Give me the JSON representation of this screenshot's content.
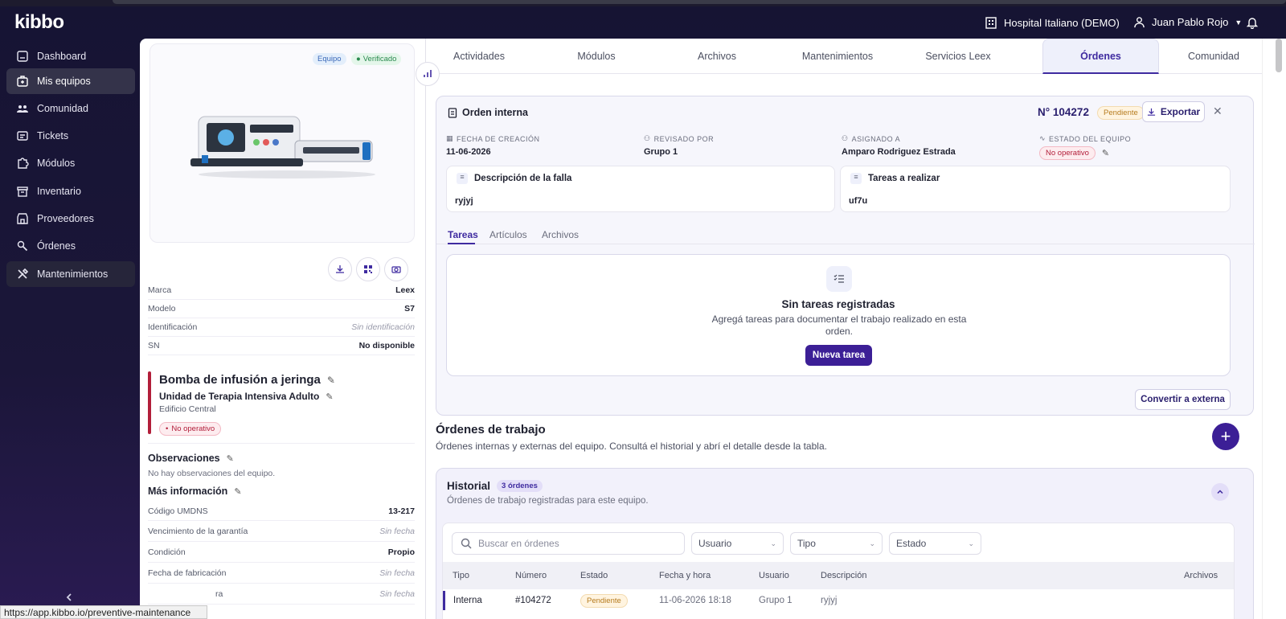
{
  "app": {
    "brand": "kibbo"
  },
  "header": {
    "hospital": "Hospital Italiano (DEMO)",
    "user": "Juan Pablo Rojo"
  },
  "sidebar": {
    "items": [
      {
        "label": "Dashboard",
        "icon": "dashboard-icon"
      },
      {
        "label": "Mis equipos",
        "icon": "equipment-icon",
        "active": true
      },
      {
        "label": "Comunidad",
        "icon": "community-icon"
      },
      {
        "label": "Tickets",
        "icon": "ticket-icon"
      },
      {
        "label": "Módulos",
        "icon": "puzzle-icon"
      },
      {
        "label": "Inventario",
        "icon": "archive-icon"
      },
      {
        "label": "Proveedores",
        "icon": "store-icon"
      },
      {
        "label": "Órdenes",
        "icon": "tools-icon"
      },
      {
        "label": "Mantenimientos",
        "icon": "maintenance-icon"
      }
    ]
  },
  "status_url": "https://app.kibbo.io/preventive-maintenance",
  "equipment": {
    "badges": {
      "equipo": "Equipo",
      "verificado": "Verificado"
    },
    "specs": [
      {
        "key": "Marca",
        "value": "Leex"
      },
      {
        "key": "Modelo",
        "value": "S7"
      },
      {
        "key": "Identificación",
        "value": "Sin identificación"
      },
      {
        "key": "SN",
        "value": "No disponible"
      }
    ],
    "name": "Bomba de infusión a jeringa",
    "unit": "Unidad de Terapia Intensiva Adulto",
    "building": "Edificio Central",
    "status": "No operativo",
    "observations_title": "Observaciones",
    "observations_text": "No hay observaciones del equipo.",
    "more_title": "Más información",
    "more": [
      {
        "key": "Código UMDNS",
        "value": "13-217"
      },
      {
        "key": "Vencimiento de la garantía",
        "value": "Sin fecha"
      },
      {
        "key": "Condición",
        "value": "Propio"
      },
      {
        "key": "Fecha de fabricación",
        "value": "Sin fecha"
      },
      {
        "key": "ra",
        "value": "Sin fecha"
      }
    ]
  },
  "tabs": [
    "Actividades",
    "Módulos",
    "Archivos",
    "Mantenimientos",
    "Servicios Leex",
    "Órdenes",
    "Comunidad"
  ],
  "active_tab": "Órdenes",
  "order": {
    "title": "Orden interna",
    "number": "N° 104272",
    "status": "Pendiente",
    "export_label": "Exportar",
    "meta": [
      {
        "label": "FECHA DE CREACIÓN",
        "value": "11-06-2026"
      },
      {
        "label": "REVISADO POR",
        "value": "Grupo 1"
      },
      {
        "label": "ASIGNADO A",
        "value": "Amparo Rodriguez Estrada"
      },
      {
        "label": "ESTADO DEL EQUIPO",
        "value": "No operativo"
      }
    ],
    "failure_title": "Descripción de la falla",
    "failure_text": "ryjyj",
    "tasks_title": "Tareas a realizar",
    "tasks_text": "uf7u",
    "inner_tabs": [
      "Tareas",
      "Artículos",
      "Archivos"
    ],
    "empty_title": "Sin tareas registradas",
    "empty_desc": "Agregá tareas para documentar el trabajo realizado en esta orden.",
    "new_task_label": "Nueva tarea",
    "convert_label": "Convertir a externa"
  },
  "work_orders": {
    "title": "Órdenes de trabajo",
    "subtitle": "Órdenes internas y externas del equipo. Consultá el historial y abrí el detalle desde la tabla.",
    "history_title": "Historial",
    "history_count": "3 órdenes",
    "history_sub": "Órdenes de trabajo registradas para este equipo.",
    "search_placeholder": "Buscar en órdenes",
    "filters": [
      "Usuario",
      "Tipo",
      "Estado"
    ],
    "columns": [
      "Tipo",
      "Número",
      "Estado",
      "Fecha y hora",
      "Usuario",
      "Descripción",
      "Archivos"
    ],
    "rows": [
      {
        "tipo": "Interna",
        "numero": "#104272",
        "estado": "Pendiente",
        "fecha": "11-06-2026 18:18",
        "usuario": "Grupo 1",
        "descripcion": "ryjyj"
      }
    ]
  },
  "colors": {
    "accent": "#3c1f96",
    "danger": "#b21e3a",
    "pending": "#b67b1e",
    "sidebar": "#161433"
  }
}
